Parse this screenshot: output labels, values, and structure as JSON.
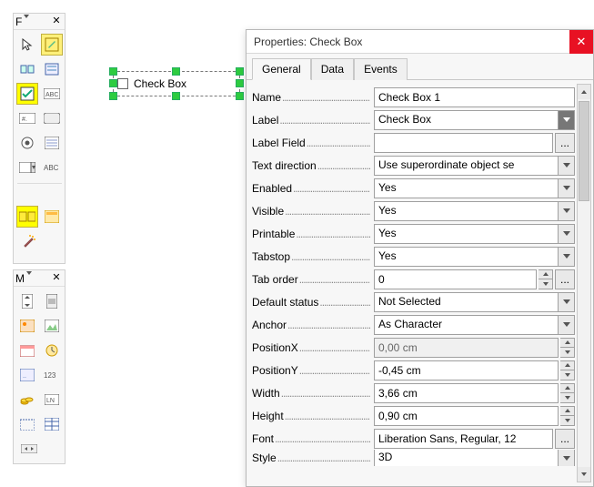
{
  "toolbars": {
    "form": {
      "title": "F"
    },
    "more": {
      "title": "M"
    }
  },
  "canvas": {
    "checkbox_label": "Check Box"
  },
  "propwin": {
    "title": "Properties: Check Box",
    "tabs": {
      "general": "General",
      "data": "Data",
      "events": "Events"
    },
    "rows": {
      "name": {
        "label": "Name",
        "value": "Check Box 1"
      },
      "label": {
        "label": "Label",
        "value": "Check Box"
      },
      "labelfield": {
        "label": "Label Field",
        "value": ""
      },
      "textdir": {
        "label": "Text direction",
        "value": "Use superordinate object se"
      },
      "enabled": {
        "label": "Enabled",
        "value": "Yes"
      },
      "visible": {
        "label": "Visible",
        "value": "Yes"
      },
      "printable": {
        "label": "Printable",
        "value": "Yes"
      },
      "tabstop": {
        "label": "Tabstop",
        "value": "Yes"
      },
      "taborder": {
        "label": "Tab order",
        "value": "0"
      },
      "defstatus": {
        "label": "Default status",
        "value": "Not Selected"
      },
      "anchor": {
        "label": "Anchor",
        "value": "As Character"
      },
      "posx": {
        "label": "PositionX",
        "value": "0,00 cm"
      },
      "posy": {
        "label": "PositionY",
        "value": "-0,45 cm"
      },
      "width": {
        "label": "Width",
        "value": "3,66 cm"
      },
      "height": {
        "label": "Height",
        "value": "0,90 cm"
      },
      "font": {
        "label": "Font",
        "value": "Liberation Sans, Regular, 12"
      },
      "style": {
        "label": "Style",
        "value": "3D"
      }
    },
    "ellipsis": "..."
  }
}
